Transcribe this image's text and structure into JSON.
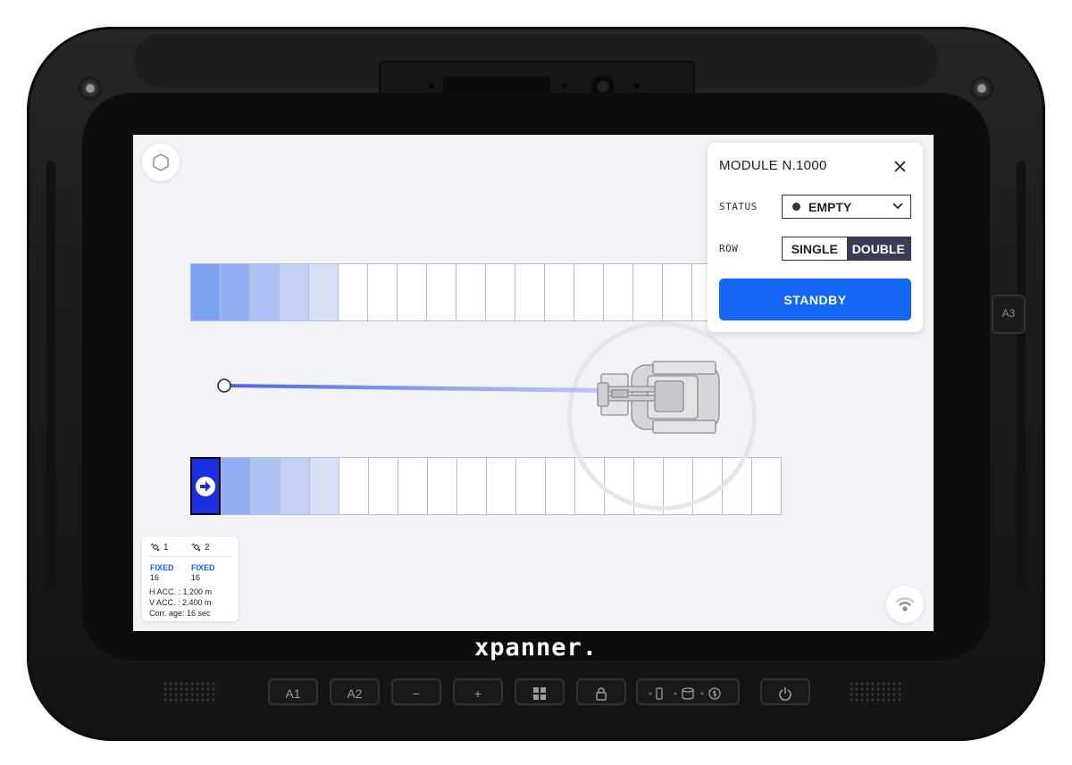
{
  "device": {
    "brand": "xpanner.",
    "side_key_label": "A3",
    "hw_buttons": [
      "A1",
      "A2",
      "−",
      "+"
    ]
  },
  "colors": {
    "accent": "#1466f5",
    "selected_module": "#1b2fe0",
    "fixed_status": "#1a5ef5"
  },
  "map": {
    "top_row_modules": 18,
    "bottom_row_modules": 20,
    "row_fill_levels": [
      0.85,
      0.7,
      0.5,
      0.35,
      0.2
    ],
    "selected_module_icon": "arrow-right-icon"
  },
  "gnss": {
    "antenna1": {
      "label": "1",
      "fix": "FIXED",
      "count": "16"
    },
    "antenna2": {
      "label": "2",
      "fix": "FIXED",
      "count": "16"
    },
    "h_acc": "H ACC. : 1.200 m",
    "v_acc": "V ACC. : 2.400 m",
    "corr_age": "Corr. age: 16 sec"
  },
  "panel": {
    "title": "MODULE N.1000",
    "status_label": "STATUS",
    "status_value": "EMPTY",
    "row_label": "ROW",
    "row_options": [
      "SINGLE",
      "DOUBLE"
    ],
    "row_selected": "DOUBLE",
    "action_label": "STANDBY"
  }
}
